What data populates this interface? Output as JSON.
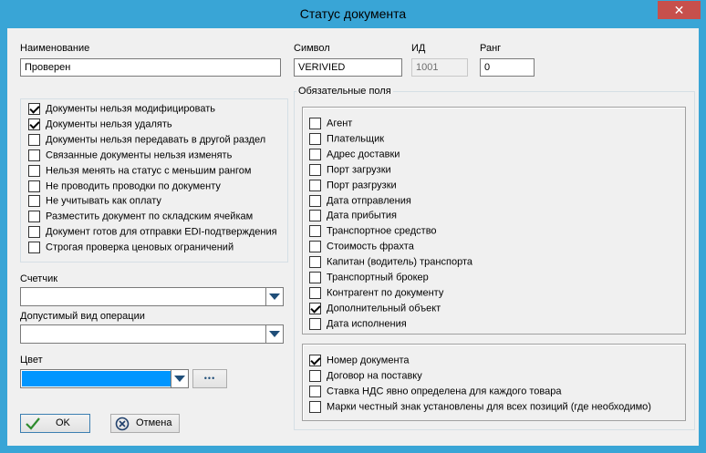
{
  "window": {
    "title": "Статус документа",
    "close_glyph": "✕"
  },
  "fields": {
    "name_label": "Наименование",
    "name_value": "Проверен",
    "symbol_label": "Символ",
    "symbol_value": "VERIVIED",
    "id_label": "ИД",
    "id_value": "1001",
    "rank_label": "Ранг",
    "rank_value": "0"
  },
  "options": [
    {
      "label": "Документы нельзя модифицировать",
      "checked": true
    },
    {
      "label": "Документы нельзя удалять",
      "checked": true
    },
    {
      "label": "Документы нельзя передавать в другой раздел",
      "checked": false
    },
    {
      "label": "Связанные документы нельзя изменять",
      "checked": false
    },
    {
      "label": "Нельзя менять на статус с меньшим рангом",
      "checked": false
    },
    {
      "label": "Не проводить проводки по документу",
      "checked": false
    },
    {
      "label": "Не учитывать как оплату",
      "checked": false
    },
    {
      "label": "Разместить документ по складским ячейкам",
      "checked": false
    },
    {
      "label": "Документ готов для отправки EDI-подтверждения",
      "checked": false
    },
    {
      "label": "Строгая проверка ценовых ограничений",
      "checked": false
    }
  ],
  "counter": {
    "label": "Счетчик",
    "value": ""
  },
  "operation": {
    "label": "Допустимый вид операции",
    "value": ""
  },
  "color": {
    "label": "Цвет",
    "value_hex": "#0096ff",
    "ellipsis": "•••"
  },
  "buttons": {
    "ok": "OK",
    "cancel": "Отмена"
  },
  "required": {
    "title": "Обязательные поля",
    "fields": [
      {
        "label": "Агент",
        "checked": false
      },
      {
        "label": "Плательщик",
        "checked": false
      },
      {
        "label": "Адрес доставки",
        "checked": false
      },
      {
        "label": "Порт загрузки",
        "checked": false
      },
      {
        "label": "Порт разгрузки",
        "checked": false
      },
      {
        "label": "Дата отправления",
        "checked": false
      },
      {
        "label": "Дата прибытия",
        "checked": false
      },
      {
        "label": "Транспортное средство",
        "checked": false
      },
      {
        "label": "Стоимость фрахта",
        "checked": false
      },
      {
        "label": "Капитан (водитель) транспорта",
        "checked": false
      },
      {
        "label": "Транспортный брокер",
        "checked": false
      },
      {
        "label": "Контрагент по документу",
        "checked": false
      },
      {
        "label": "Дополнительный объект",
        "checked": true
      },
      {
        "label": "Дата исполнения",
        "checked": false
      }
    ],
    "extra": [
      {
        "label": "Номер документа",
        "checked": true
      },
      {
        "label": "Договор на поставку",
        "checked": false
      },
      {
        "label": "Ставка НДС явно определена для каждого товара",
        "checked": false
      },
      {
        "label": "Марки честный знак установлены для всех позиций (где необходимо)",
        "checked": false
      }
    ]
  }
}
